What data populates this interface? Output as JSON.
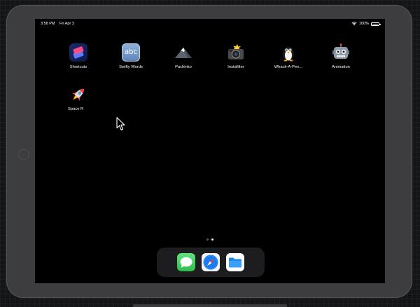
{
  "status_bar": {
    "time": "3:58 PM",
    "date": "Fri Apr 3",
    "battery": "100%"
  },
  "home_screen": {
    "apps": [
      {
        "label": "Shortcuts",
        "icon": "shortcuts-icon"
      },
      {
        "label": "Swifty Words",
        "icon": "swifty-words-icon",
        "icon_text": "abc"
      },
      {
        "label": "Pachinko",
        "icon": "mountain-icon"
      },
      {
        "label": "Instafilter",
        "icon": "camera-icon"
      },
      {
        "label": "Whack-A-Pen...",
        "icon": "penguin-icon"
      },
      {
        "label": "Animation",
        "icon": "robot-icon"
      },
      {
        "label": "Space R",
        "icon": "rocket-icon"
      }
    ]
  },
  "page_indicator": {
    "pages": 2,
    "current": 2
  },
  "dock": {
    "apps": [
      {
        "name": "Messages",
        "icon": "messages-icon"
      },
      {
        "name": "Safari",
        "icon": "safari-icon"
      },
      {
        "name": "Files",
        "icon": "files-icon"
      }
    ]
  },
  "colors": {
    "dock_background": "#1d1d1f",
    "messages_green": "#34c759",
    "safari_blue": "#1a7cf0",
    "files_blue": "#1e88e5"
  }
}
